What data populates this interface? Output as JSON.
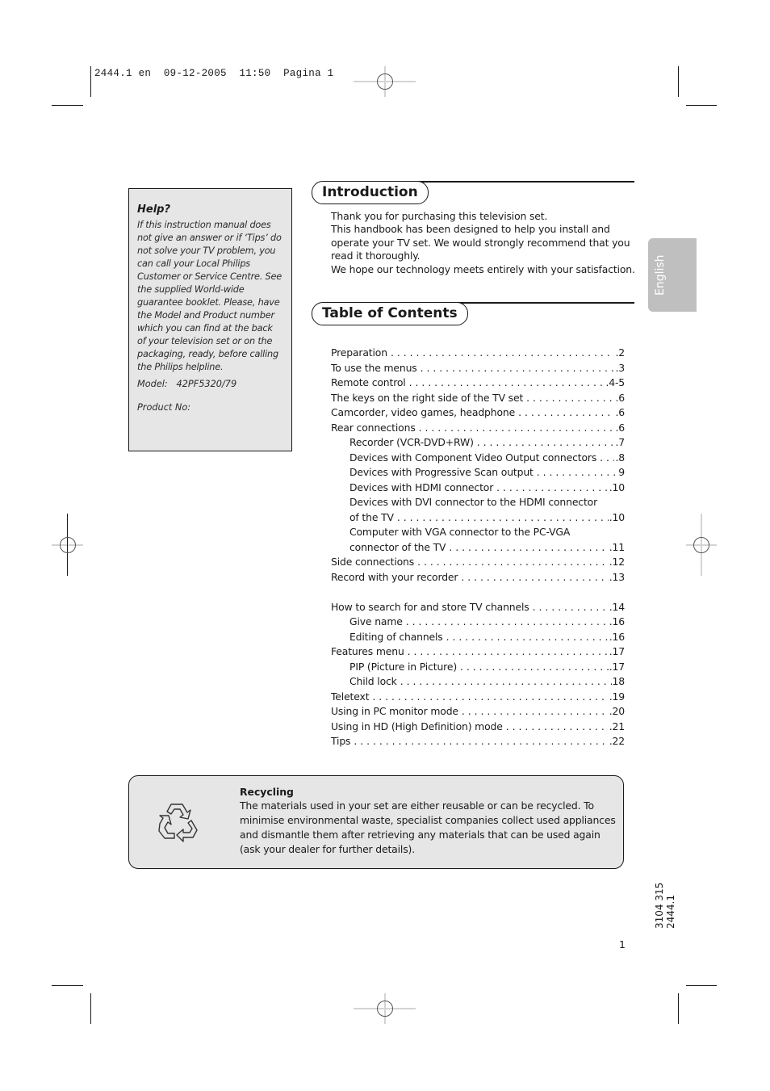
{
  "slug": {
    "file": "2444.1 en",
    "date": "09-12-2005",
    "time": "11:50",
    "page_label": "Pagina 1"
  },
  "help": {
    "title": "Help?",
    "body": "If this instruction manual does not give an answer or if ‘Tips’ do not solve your TV problem, you can call your Local Philips Customer or Service Centre. See the supplied World-wide guarantee booklet. Please, have the Model and Product number which you can find at the back of your television set or on the packaging, ready, before calling the Philips helpline.",
    "model_label": "Model:",
    "model_value": "42PF5320/79",
    "product_label": "Product No:"
  },
  "introduction": {
    "heading": "Introduction",
    "lines": [
      "Thank you for purchasing this television set.",
      "This handbook has been designed to help you install and operate your TV set.  We would strongly recommend that you read it thoroughly.",
      "We hope our technology meets entirely with your satisfaction."
    ]
  },
  "language_tab": {
    "label": "English",
    "color": "#bfbfbf"
  },
  "toc": {
    "heading": "Table of Contents",
    "entries": [
      {
        "title": "Preparation",
        "page": ".2",
        "level": 0
      },
      {
        "title": "To use the menus",
        "page": ".3",
        "level": 0
      },
      {
        "title": "Remote control",
        "page": ".4-5",
        "level": 0
      },
      {
        "title": "The keys on the right side of the TV set",
        "page": ".6",
        "level": 0
      },
      {
        "title": "Camcorder, video games, headphone",
        "page": ".6",
        "level": 0
      },
      {
        "title": "Rear connections",
        "page": ".6",
        "level": 0
      },
      {
        "title": "Recorder (VCR-DVD+RW)",
        "page": ".7",
        "level": 1
      },
      {
        "title": "Devices with Component Video Output connectors",
        "page": ".8",
        "level": 1
      },
      {
        "title": "Devices with Progressive Scan output",
        "page": "9",
        "level": 1
      },
      {
        "title": "Devices with HDMI connector",
        "page": ".10",
        "level": 1
      },
      {
        "title": "Devices with DVI connector to the HDMI connector",
        "title2": "of the TV",
        "page": ".10",
        "level": 1
      },
      {
        "title": "Computer with VGA connector to the PC-VGA",
        "title2": "connector of the TV",
        "page": ".11",
        "level": 1
      },
      {
        "title": "Side connections",
        "page": ".12",
        "level": 0
      },
      {
        "title": "Record with your recorder",
        "page": ".13",
        "level": 0
      },
      {
        "title": "How to search for and store TV channels",
        "page": ".14",
        "level": 0
      },
      {
        "title": "Give name",
        "page": ".16",
        "level": 1
      },
      {
        "title": "Editing of channels",
        "page": ".16",
        "level": 1
      },
      {
        "title": "Features menu",
        "page": ".17",
        "level": 0
      },
      {
        "title": "PIP (Picture in Picture)",
        "page": ".17",
        "level": 1
      },
      {
        "title": "Child lock",
        "page": "18",
        "level": 1
      },
      {
        "title": "Teletext",
        "page": ".19",
        "level": 0
      },
      {
        "title": "Using in PC monitor mode",
        "page": ".20",
        "level": 0
      },
      {
        "title": "Using in HD (High Definition) mode",
        "page": ".21",
        "level": 0
      },
      {
        "title": "Tips",
        "page": ".22",
        "level": 0
      }
    ]
  },
  "recycling": {
    "icon": "recycle-icon",
    "title": "Recycling",
    "body": "The materials used in your set are either reusable or can be recycled. To minimise environmental waste, specialist companies collect used appliances and dismantle them after retrieving any materials that can be used again (ask your dealer for further details)."
  },
  "doc_number": "3104 315 2444.1",
  "page_number": "1"
}
